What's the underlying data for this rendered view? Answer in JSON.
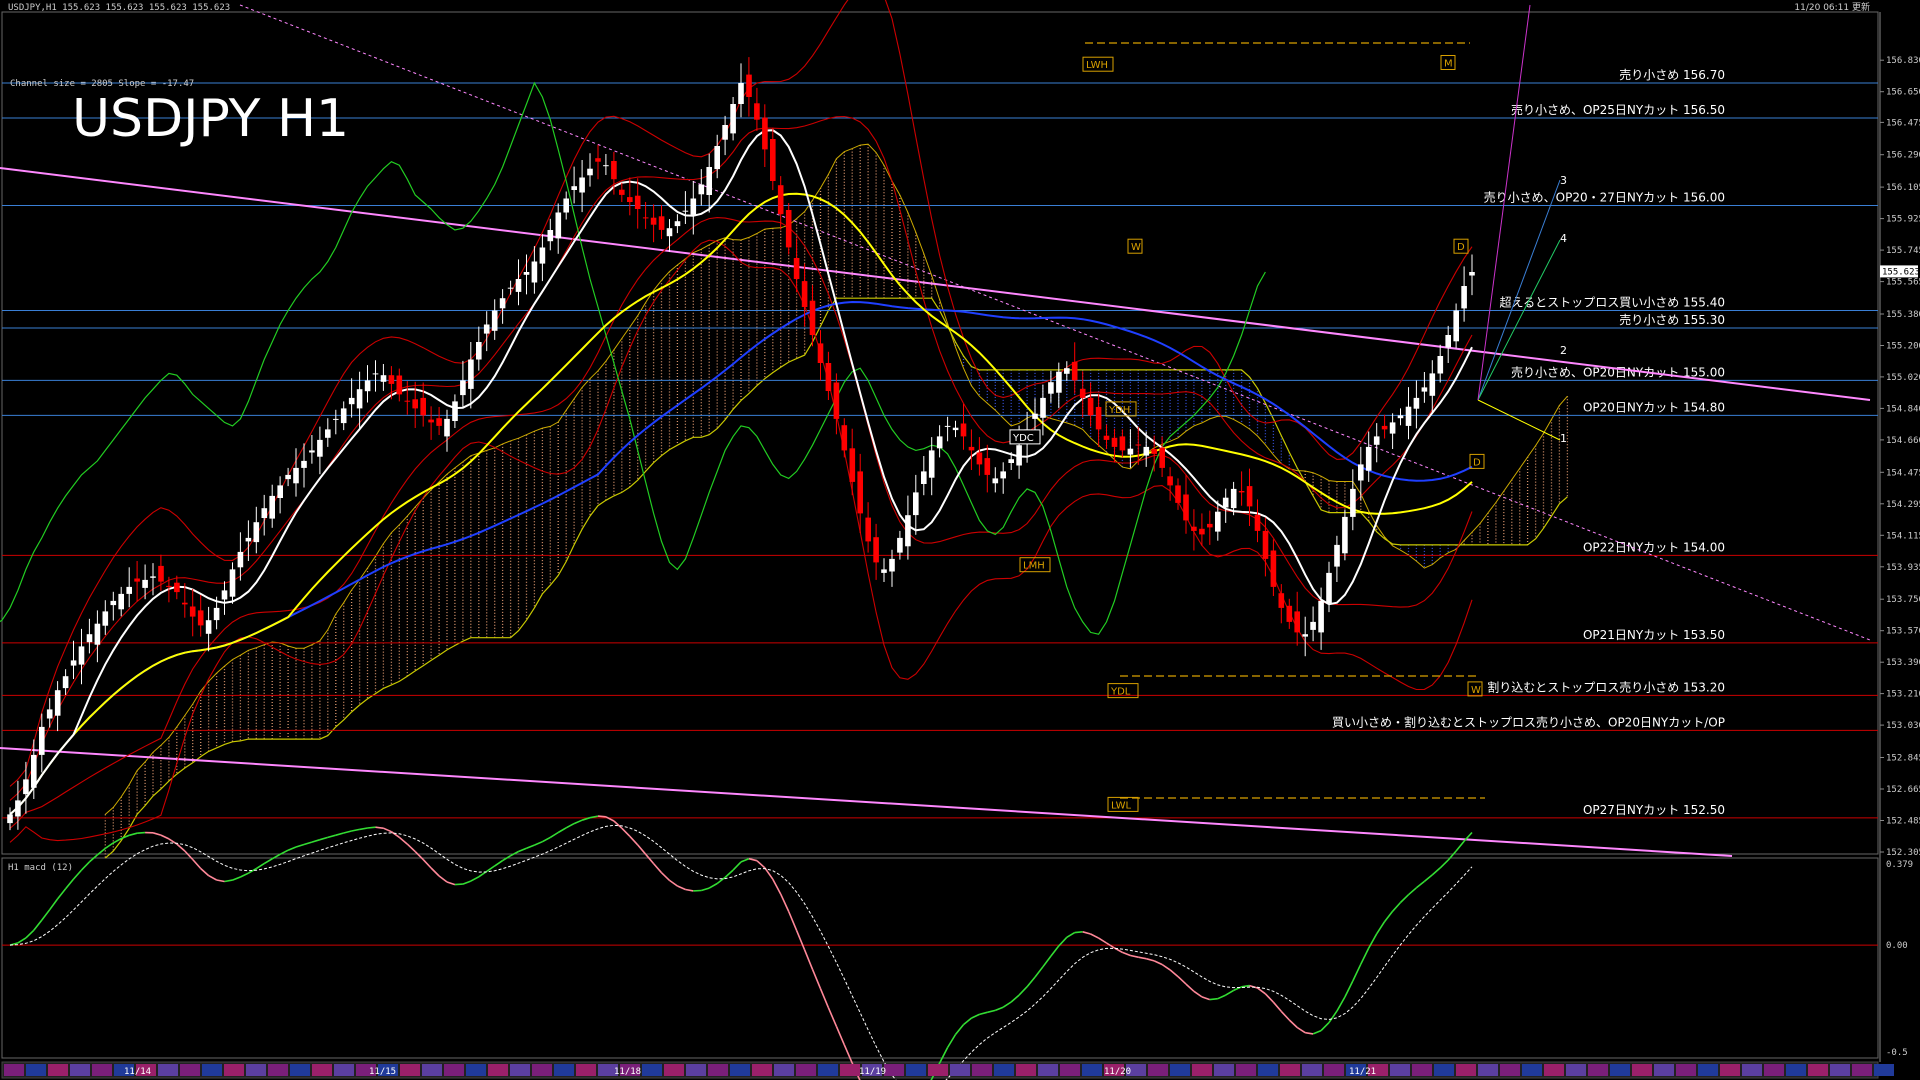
{
  "header": {
    "symbol_line": "USDJPY,H1  155.623 155.623 155.623 155.623",
    "timestamp": "11/20 06:11 更新",
    "channel_info": "Channel size = 2805 Slope = -17.47",
    "big_title": "USDJPY H1"
  },
  "colors": {
    "background": "#000000",
    "bull_candle": "#ffffff",
    "bear_candle": "#ff0000",
    "sma_fast": "#ffffff",
    "sma_mid": "#ffff00",
    "sma_slow": "#1f3fff",
    "bollinger": "#cc0000",
    "chikou": "#22cc22",
    "kumo_bull": "#ffb080",
    "kumo_bear": "#4060ff",
    "channel": "#ff88ff",
    "level_sell": "#3a7fd5",
    "level_op": "#cc0000",
    "macd_up": "#33dd33",
    "macd_down": "#ff8899",
    "macd_signal": "#ffffff"
  },
  "chart_data": {
    "type": "candlestick",
    "price_axis": {
      "ylim": [
        152.305,
        156.9
      ],
      "ticks": [
        "156.830",
        "156.650",
        "156.475",
        "156.290",
        "156.105",
        "155.925",
        "155.745",
        "155.565",
        "155.380",
        "155.200",
        "155.020",
        "154.840",
        "154.660",
        "154.475",
        "154.295",
        "154.115",
        "153.935",
        "153.750",
        "153.570",
        "153.390",
        "153.210",
        "153.030",
        "152.845",
        "152.665",
        "152.485",
        "152.305"
      ],
      "current_price": "155.623"
    },
    "date_labels": [
      "11/14",
      "11/15",
      "11/18",
      "11/19",
      "11/20",
      "11/21"
    ],
    "levels": [
      {
        "price": 156.7,
        "label": "売り小さめ 156.70",
        "kind": "sell"
      },
      {
        "price": 156.5,
        "label": "売り小さめ、OP25日NYカット 156.50",
        "kind": "sell"
      },
      {
        "price": 156.0,
        "label": "売り小さめ、OP20・27日NYカット 156.00",
        "kind": "sell"
      },
      {
        "price": 155.4,
        "label": "超えるとストップロス買い小さめ 155.40",
        "kind": "sell"
      },
      {
        "price": 155.3,
        "label": "売り小さめ 155.30",
        "kind": "sell"
      },
      {
        "price": 155.0,
        "label": "売り小さめ、OP20日NYカット 155.00",
        "kind": "sell"
      },
      {
        "price": 154.8,
        "label": "OP20日NYカット 154.80",
        "kind": "sell"
      },
      {
        "price": 154.0,
        "label": "OP22日NYカット 154.00",
        "kind": "op"
      },
      {
        "price": 153.5,
        "label": "OP21日NYカット 153.50",
        "kind": "op"
      },
      {
        "price": 153.2,
        "label": "割り込むとストップロス売り小さめ 153.20",
        "kind": "op"
      },
      {
        "price": 153.0,
        "label": "買い小さめ・割り込むとストップロス売り小さめ、OP20日NYカット/OP",
        "kind": "op"
      },
      {
        "price": 152.5,
        "label": "OP27日NYカット 152.50",
        "kind": "op"
      }
    ],
    "markers": [
      {
        "text": "LWH",
        "price": 156.79
      },
      {
        "text": "YDC",
        "price": 154.66
      },
      {
        "text": "LMH",
        "price": 153.93
      },
      {
        "text": "YDH",
        "price": 154.82
      },
      {
        "text": "YDL",
        "price": 153.21
      },
      {
        "text": "LWL",
        "price": 152.56
      },
      {
        "text": "W",
        "price": 155.75
      },
      {
        "text": "D",
        "price": 155.75
      },
      {
        "text": "D",
        "price": 154.52
      },
      {
        "text": "W",
        "price": 153.22
      },
      {
        "text": "M",
        "price": 156.8
      }
    ],
    "projection_labels": [
      "1",
      "2",
      "3",
      "4"
    ],
    "closes": [
      152.52,
      152.6,
      152.72,
      152.86,
      153.02,
      153.12,
      153.23,
      153.31,
      153.4,
      153.48,
      153.55,
      153.61,
      153.68,
      153.74,
      153.78,
      153.82,
      153.85,
      153.86,
      153.88,
      153.85,
      153.82,
      153.79,
      153.72,
      153.65,
      153.6,
      153.63,
      153.7,
      153.8,
      153.92,
      154.02,
      154.1,
      154.19,
      154.27,
      154.34,
      154.4,
      154.46,
      154.5,
      154.54,
      154.6,
      154.66,
      154.72,
      154.78,
      154.84,
      154.9,
      154.95,
      155.0,
      155.04,
      155.03,
      154.98,
      154.92,
      154.88,
      154.84,
      154.8,
      154.76,
      154.74,
      154.78,
      154.88,
      155.0,
      155.12,
      155.22,
      155.32,
      155.4,
      155.47,
      155.53,
      155.58,
      155.62,
      155.68,
      155.76,
      155.86,
      155.96,
      156.04,
      156.11,
      156.16,
      156.21,
      156.25,
      156.23,
      156.15,
      156.06,
      156.02,
      155.98,
      155.93,
      155.89,
      155.86,
      155.87,
      155.91,
      155.97,
      156.04,
      156.12,
      156.22,
      156.34,
      156.46,
      156.58,
      156.7,
      156.62,
      156.49,
      156.32,
      156.14,
      155.95,
      155.76,
      155.58,
      155.42,
      155.26,
      155.1,
      154.94,
      154.78,
      154.6,
      154.42,
      154.24,
      154.08,
      153.96,
      153.92,
      153.98,
      154.1,
      154.23,
      154.36,
      154.48,
      154.6,
      154.68,
      154.74,
      154.73,
      154.68,
      154.6,
      154.52,
      154.46,
      154.44,
      154.48,
      154.55,
      154.63,
      154.72,
      154.81,
      154.9,
      154.99,
      155.05,
      155.07,
      155.0,
      154.9,
      154.8,
      154.72,
      154.66,
      154.62,
      154.6,
      154.61,
      154.63,
      154.62,
      154.58,
      154.5,
      154.4,
      154.3,
      154.2,
      154.14,
      154.12,
      154.16,
      154.25,
      154.33,
      154.38,
      154.36,
      154.28,
      154.14,
      153.98,
      153.82,
      153.7,
      153.62,
      153.56,
      153.55,
      153.62,
      153.74,
      153.9,
      154.06,
      154.22,
      154.38,
      154.52,
      154.62,
      154.68,
      154.72,
      154.76,
      154.8,
      154.85,
      154.9,
      154.96,
      155.04,
      155.14,
      155.26,
      155.4,
      155.54,
      155.62
    ],
    "macd": {
      "ylim": [
        -0.5,
        0.379
      ],
      "ticks": [
        "0.379",
        "0.00",
        "-0.5"
      ],
      "signal_label": "H1  macd (12)"
    }
  }
}
